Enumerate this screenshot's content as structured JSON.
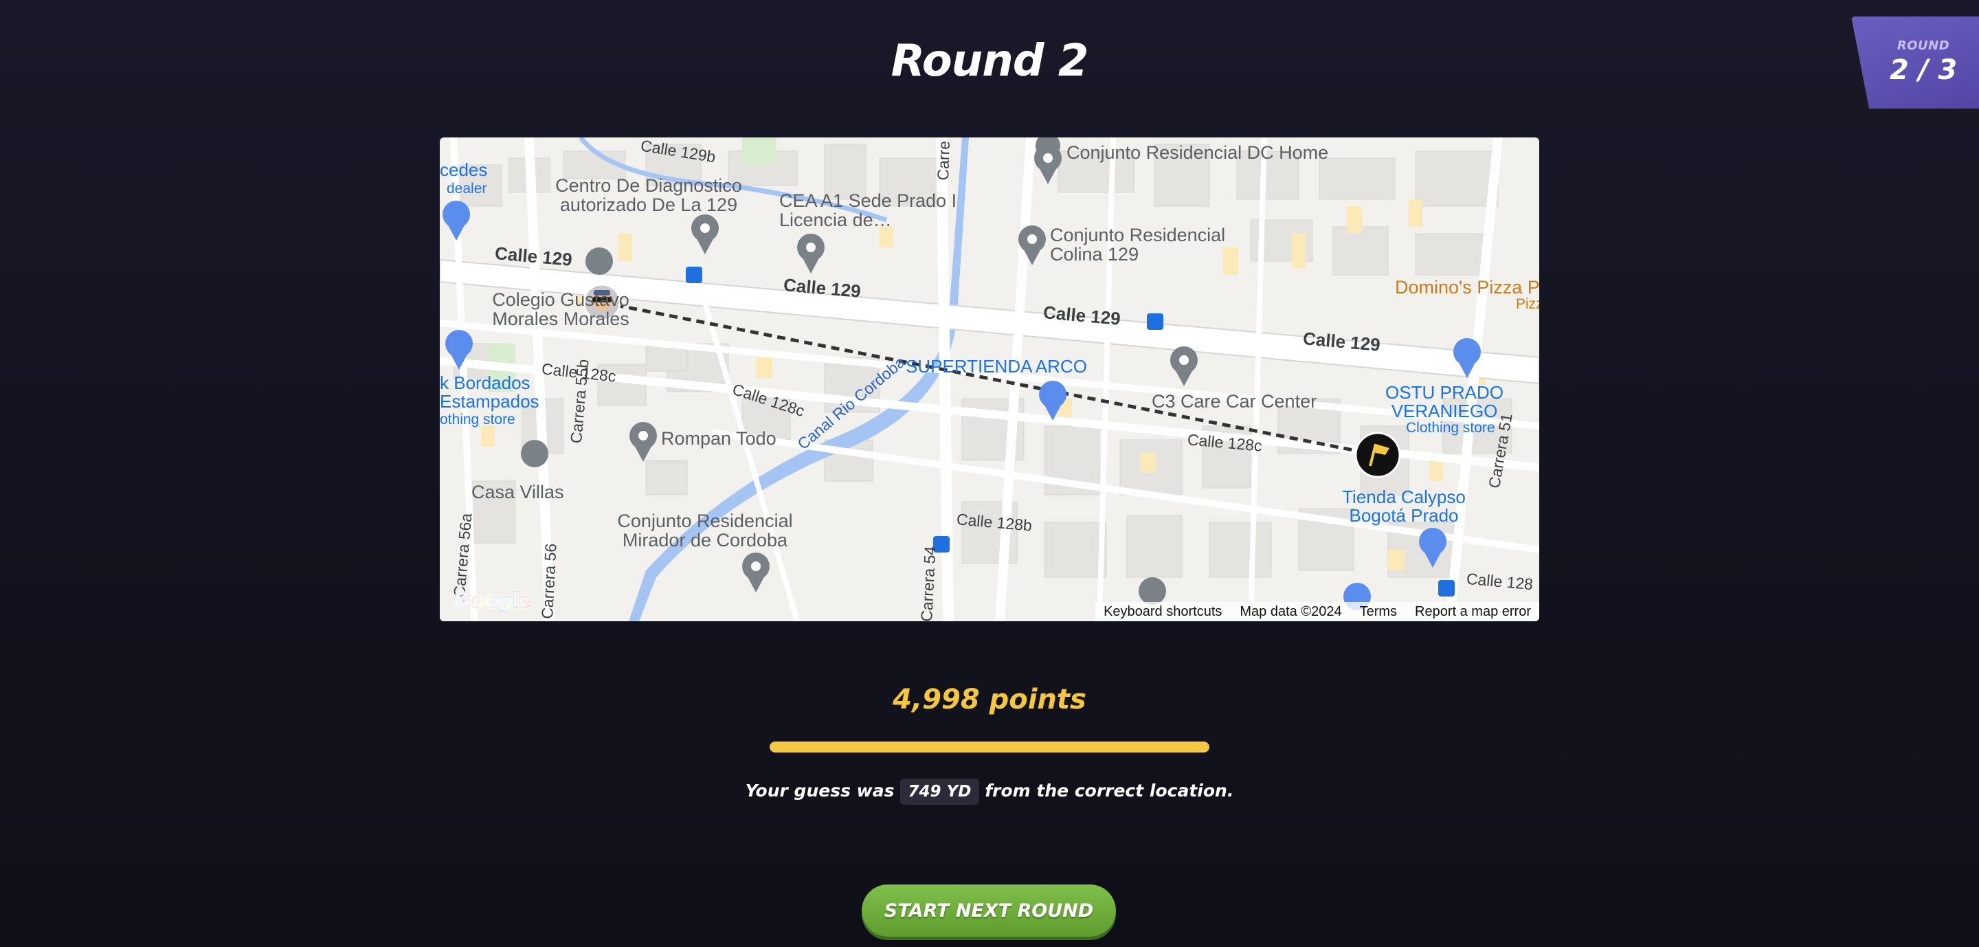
{
  "header": {
    "title": "Round 2"
  },
  "round_badge": {
    "label": "ROUND",
    "value": "2 / 3"
  },
  "map": {
    "poi_labels": [
      "Conjunto Residencial DC Home",
      "Centro De Diagnostico autorizado De La 129",
      "CEA A1 Sede Prado I Licencia de…",
      "Conjunto Residencial Colina 129",
      "Colegio Gustavo Morales Morales",
      "Rompan Todo",
      "Casa Villas",
      "C3 Care Car Center",
      "Conjunto Residencial Mirador de Cordoba"
    ],
    "street_labels": [
      "Calle 129",
      "Calle 129",
      "Calle 129",
      "Calle 129",
      "Calle 129b",
      "Calle 128c",
      "Calle 128c",
      "Calle 128c",
      "Calle 128b",
      "Calle 128",
      "Carrera 55b",
      "Carrera 56a",
      "Carrera 56",
      "Carrera 54",
      "Carrera 51",
      "Carre"
    ],
    "business_labels": [
      "SUPERTIENDA ARCO",
      "OSTU PRADO VERANIEGO",
      "Clothing store",
      "k Bordados Estampados",
      "othing store",
      "Tienda Calypso Bogotá Prado",
      "cedes",
      "dealer"
    ],
    "orange_labels": [
      "Domino's Pizza P",
      "Pizz"
    ],
    "canal_label": "Canal Rio Cordoba",
    "google_logo": "Google",
    "attribution": [
      "Keyboard shortcuts",
      "Map data ©2024",
      "Terms",
      "Report a map error"
    ],
    "icons": {
      "guess_marker": "player-avatar-icon",
      "answer_marker": "flag-icon"
    },
    "route_color": "#333333"
  },
  "result": {
    "points": "4,998 points",
    "score_fraction": 0.9996,
    "guess_prefix": "Your guess was",
    "distance": "749 YD",
    "guess_suffix": "from the correct location."
  },
  "actions": {
    "next_round_label": "START NEXT ROUND"
  },
  "colors": {
    "accent_yellow": "#f5c842",
    "button_green": "#6aaa3a",
    "badge_purple": "#5b4fb0"
  }
}
